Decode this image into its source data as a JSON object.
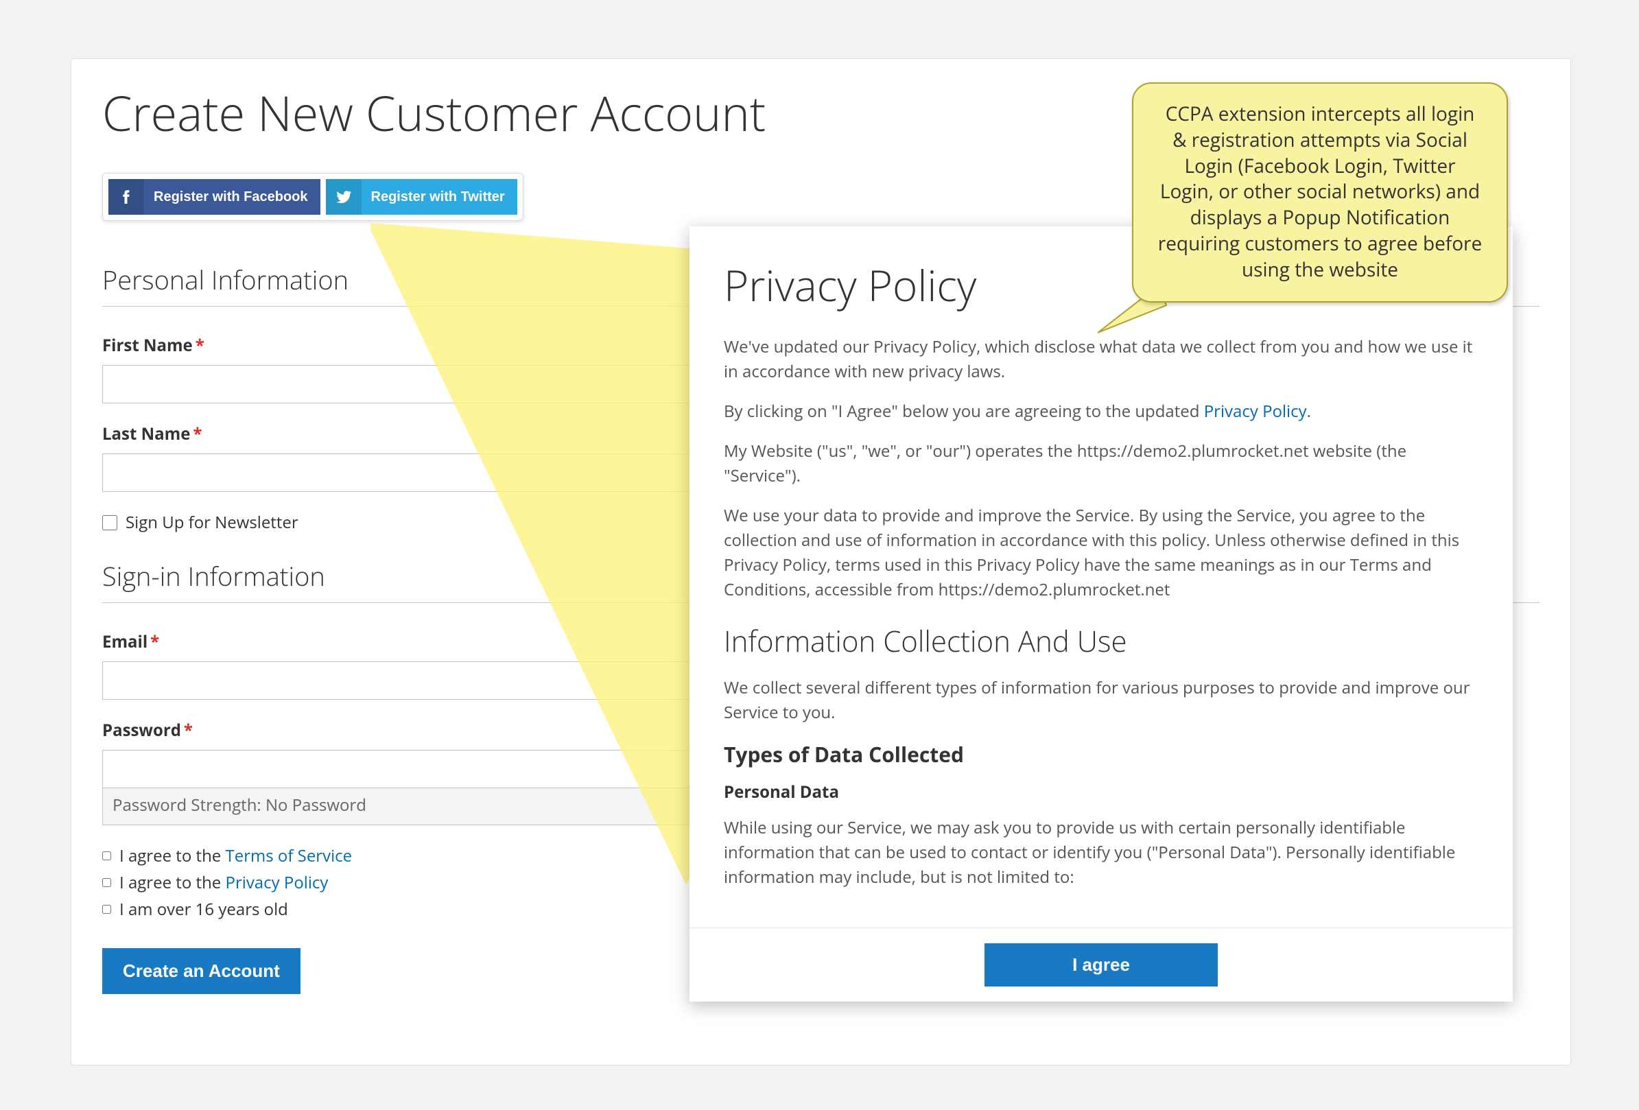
{
  "page": {
    "title": "Create New Customer Account"
  },
  "social": {
    "facebook_label": "Register with Facebook",
    "twitter_label": "Register with Twitter"
  },
  "sections": {
    "personal": "Personal Information",
    "signin": "Sign-in Information"
  },
  "fields": {
    "first_name": "First Name",
    "last_name": "Last Name",
    "newsletter": "Sign Up for Newsletter",
    "email": "Email",
    "password": "Password",
    "password_strength": "Password Strength: No Password"
  },
  "agreements": {
    "tos_prefix": "I agree to the ",
    "tos_link": "Terms of Service",
    "pp_prefix": "I agree to the ",
    "pp_link": "Privacy Policy",
    "age": "I am over 16 years old"
  },
  "buttons": {
    "create_account": "Create an Account",
    "i_agree": "I agree"
  },
  "popup": {
    "title": "Privacy Policy",
    "p1": "We've updated our Privacy Policy, which disclose what data we collect from you and how we use it in accordance with new privacy laws.",
    "p2_prefix": "By clicking on \"I Agree\" below you are agreeing to the updated ",
    "p2_link": "Privacy Policy",
    "p2_suffix": ".",
    "p3": "My Website (\"us\", \"we\", or \"our\") operates the https://demo2.plumrocket.net website (the \"Service\").",
    "p4": "We use your data to provide and improve the Service. By using the Service, you agree to the collection and use of information in accordance with this policy. Unless otherwise defined in this Privacy Policy, terms used in this Privacy Policy have the same meanings as in our Terms and Conditions, accessible from https://demo2.plumrocket.net",
    "h2": "Information Collection And Use",
    "p5": "We collect several different types of information for various purposes to provide and improve our Service to you.",
    "h3": "Types of Data Collected",
    "h4": "Personal Data",
    "p6": "While using our Service, we may ask you to provide us with certain personally identifiable information that can be used to contact or identify you (\"Personal Data\"). Personally identifiable information may include, but is not limited to:"
  },
  "callout": {
    "text": "CCPA extension intercepts all login & registration attempts via Social Login (Facebook Login, Twitter Login, or other social networks) and displays a Popup Notification requiring customers to agree before using the website"
  }
}
